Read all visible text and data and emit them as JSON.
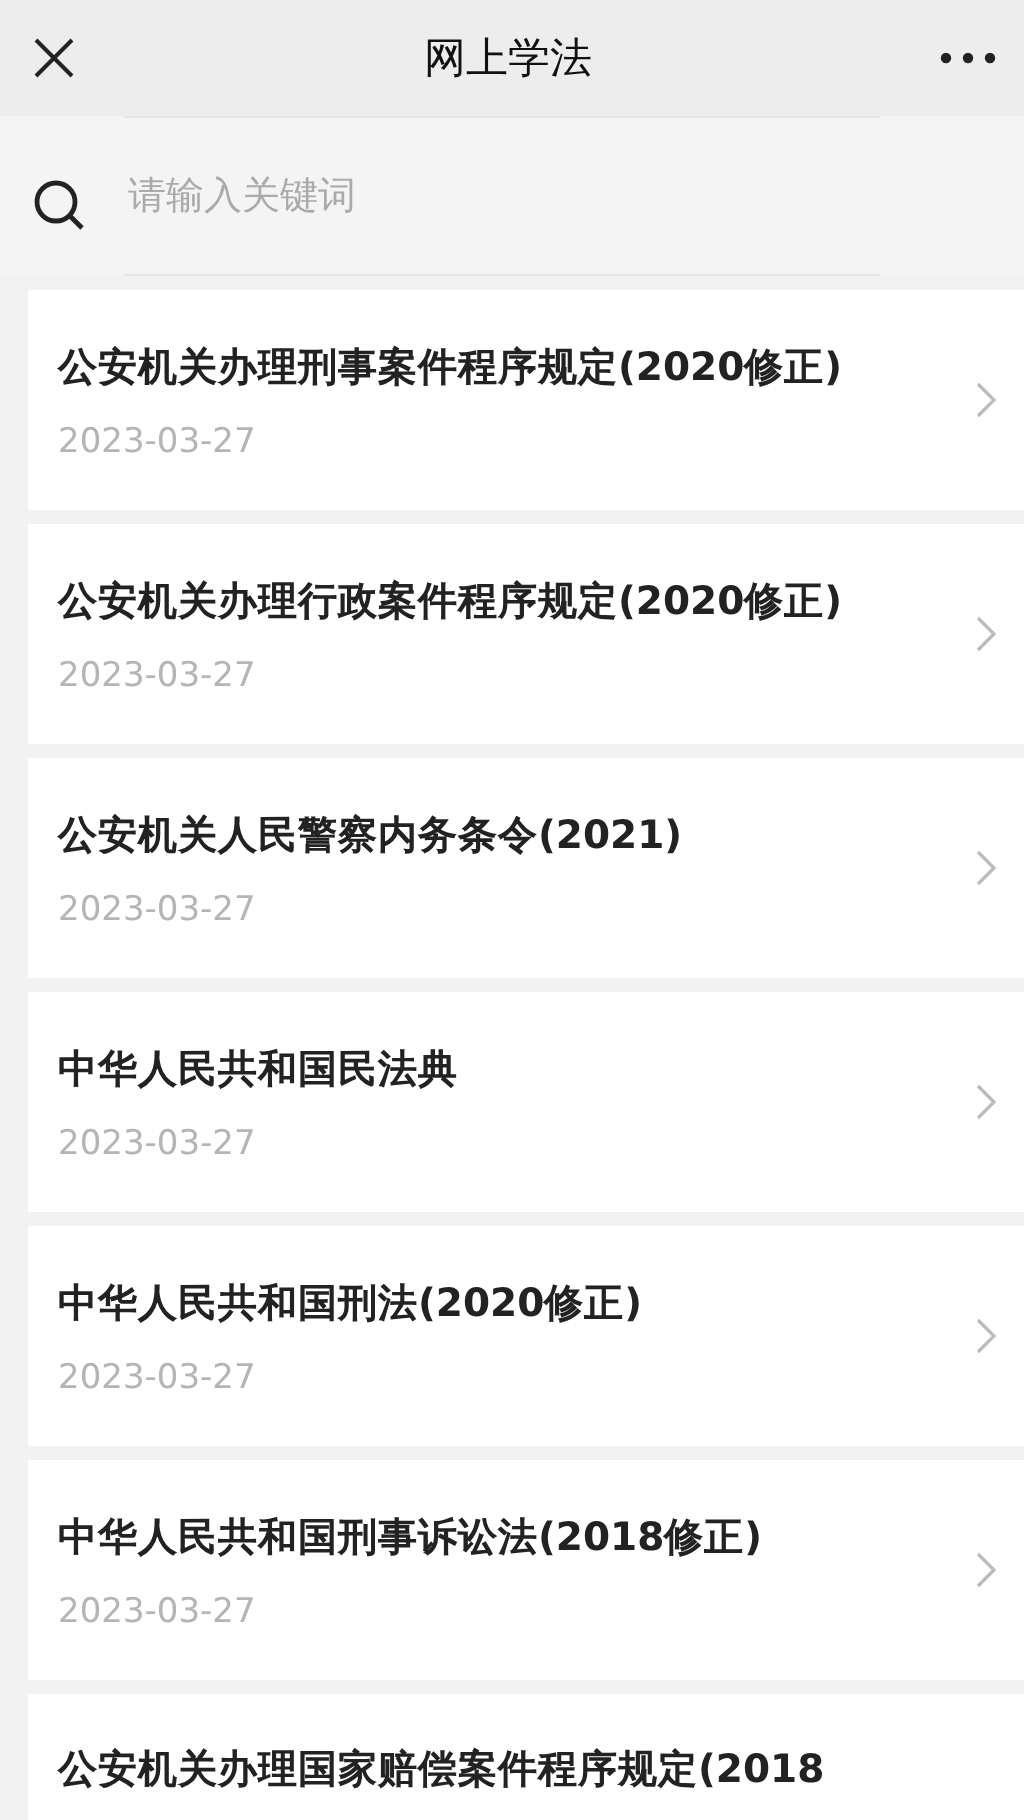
{
  "header": {
    "title": "网上学法"
  },
  "search": {
    "placeholder": "请输入关键词"
  },
  "items": [
    {
      "title": "公安机关办理刑事案件程序规定(2020修正)",
      "date": "2023-03-27"
    },
    {
      "title": "公安机关办理行政案件程序规定(2020修正)",
      "date": "2023-03-27"
    },
    {
      "title": "公安机关人民警察内务条令(2021)",
      "date": "2023-03-27"
    },
    {
      "title": "中华人民共和国民法典",
      "date": "2023-03-27"
    },
    {
      "title": "中华人民共和国刑法(2020修正)",
      "date": "2023-03-27"
    },
    {
      "title": "中华人民共和国刑事诉讼法(2018修正)",
      "date": "2023-03-27"
    },
    {
      "title": "公安机关办理国家赔偿案件程序规定(2018"
    }
  ]
}
